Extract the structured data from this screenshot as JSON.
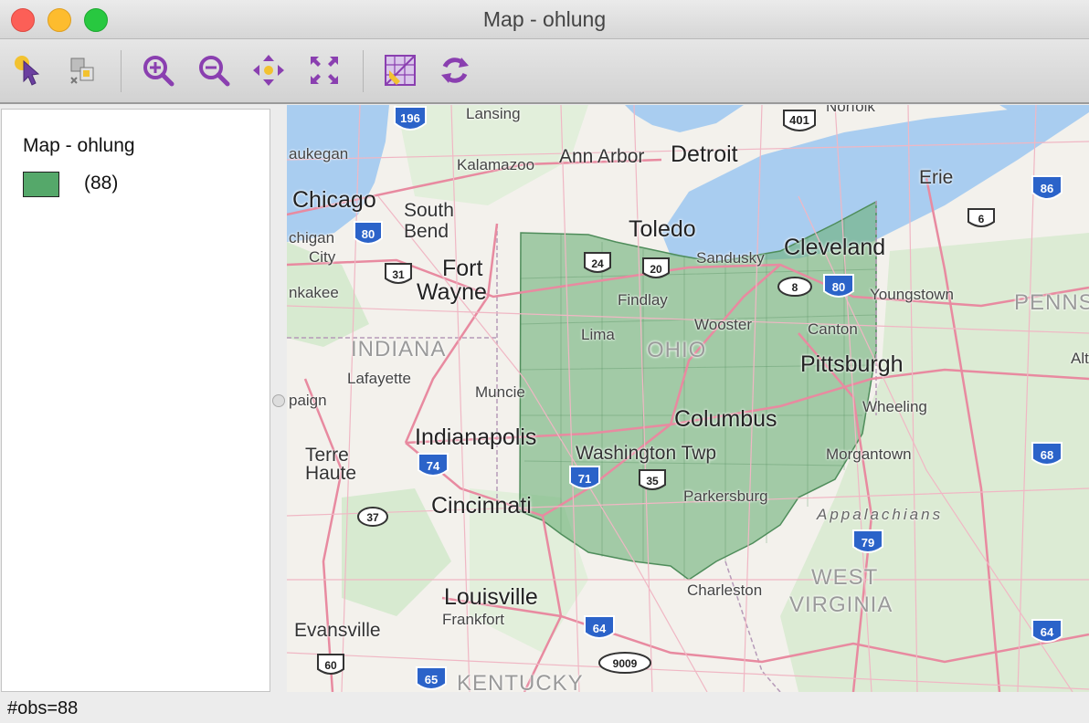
{
  "window": {
    "title": "Map - ohlung"
  },
  "toolbar": {
    "buttons": [
      {
        "name": "select-tool-button",
        "icon": "pointer-icon"
      },
      {
        "name": "selection-mode-button",
        "icon": "select-layers-icon"
      },
      {
        "name": "zoom-in-button",
        "icon": "zoom-in-icon"
      },
      {
        "name": "zoom-out-button",
        "icon": "zoom-out-icon"
      },
      {
        "name": "pan-button",
        "icon": "pan-arrows-icon"
      },
      {
        "name": "fit-to-window-button",
        "icon": "full-extent-icon"
      },
      {
        "name": "basemap-button",
        "icon": "basemap-grid-icon"
      },
      {
        "name": "refresh-button",
        "icon": "refresh-icon"
      }
    ]
  },
  "legend": {
    "title": "Map - ohlung",
    "items": [
      {
        "color": "#55a86a",
        "label": "(88)"
      }
    ]
  },
  "map": {
    "labels": {
      "chicago": "Chicago",
      "waukegan": "aukegan",
      "michigan_city_1": "chigan",
      "michigan_city_2": "City",
      "kankakee": "nkakee",
      "south_bend_1": "South",
      "south_bend_2": "Bend",
      "fort_wayne_1": "Fort",
      "fort_wayne_2": "Wayne",
      "lansing": "Lansing",
      "kalamazoo": "Kalamazoo",
      "ann_arbor": "Ann Arbor",
      "detroit": "Detroit",
      "norfolk": "Norfolk",
      "erie": "Erie",
      "toledo": "Toledo",
      "sandusky": "Sandusky",
      "cleveland": "Cleveland",
      "youngstown": "Youngstown",
      "penns": "PENNS",
      "findlay": "Findlay",
      "lima": "Lima",
      "wooster": "Wooster",
      "canton": "Canton",
      "pittsburgh": "Pittsburgh",
      "altoona": "Alto",
      "indiana": "INDIANA",
      "ohio": "OHIO",
      "lafayette": "Lafayette",
      "muncie": "Muncie",
      "champaign": "paign",
      "columbus": "Columbus",
      "wheeling": "Wheeling",
      "indianapolis": "Indianapolis",
      "washington_twp": "Washington Twp",
      "morgantown": "Morgantown",
      "terre_haute_1": "Terre",
      "terre_haute_2": "Haute",
      "parkersburg": "Parkersburg",
      "cincinnati": "Cincinnati",
      "appalachians": "Appalachians",
      "west_virginia_1": "WEST",
      "west_virginia_2": "VIRGINIA",
      "charleston": "Charleston",
      "louisville": "Louisville",
      "frankfort": "Frankfort",
      "evansville": "Evansville",
      "kentucky": "KENTUCKY"
    },
    "shields": {
      "i196": "196",
      "us401": "401",
      "i86": "86",
      "r6": "6",
      "i80a": "80",
      "us24": "24",
      "us20": "20",
      "us31": "31",
      "r8": "8",
      "i80b": "80",
      "i74": "74",
      "i71": "71",
      "us35": "35",
      "i68": "68",
      "r37": "37",
      "i79": "79",
      "i64a": "64",
      "i64b": "64",
      "r9009": "9009",
      "r60": "60",
      "i65": "65"
    }
  },
  "status": {
    "text": "#obs=88"
  }
}
